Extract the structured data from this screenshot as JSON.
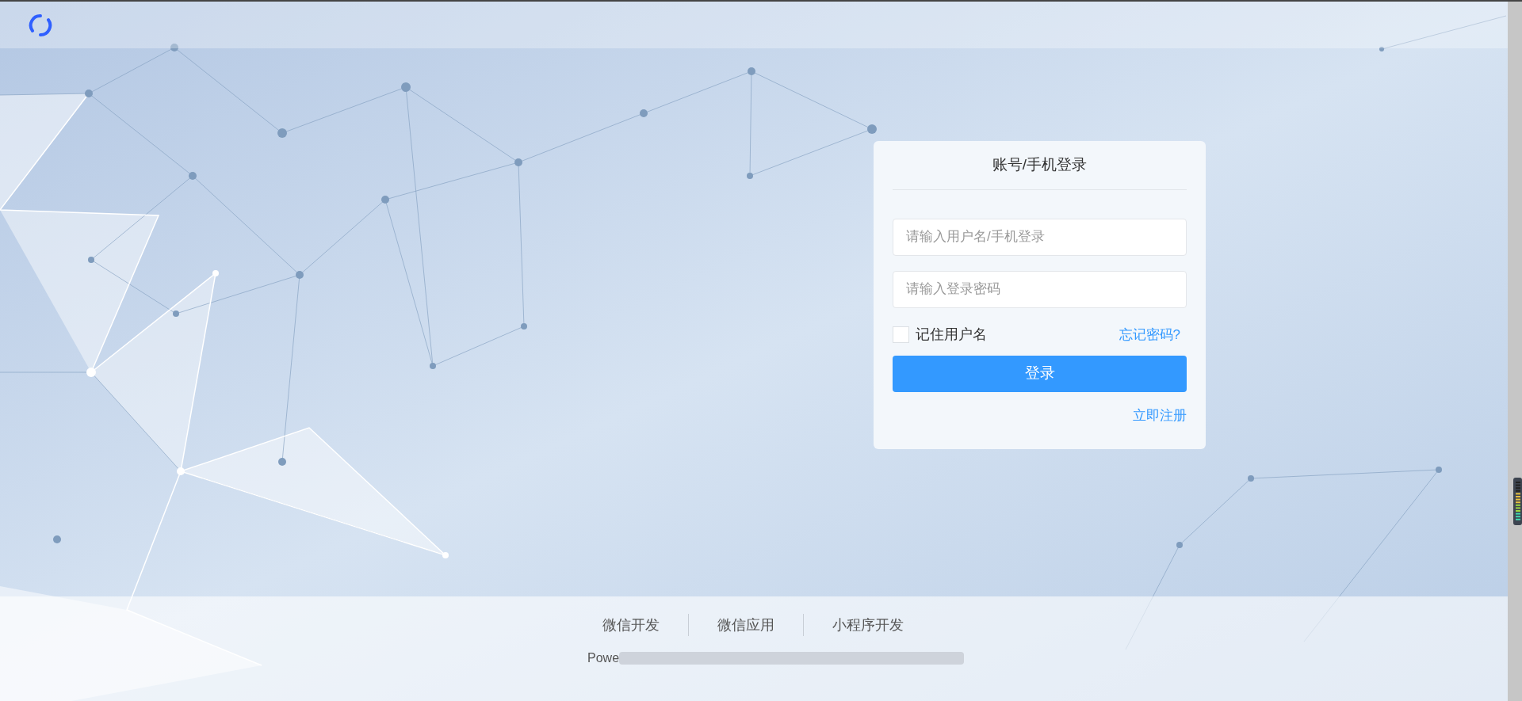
{
  "login_card": {
    "title": "账号/手机登录",
    "username": {
      "placeholder": "请输入用户名/手机登录"
    },
    "password": {
      "placeholder": "请输入登录密码"
    },
    "remember": {
      "label": "记住用户名",
      "checked": false
    },
    "forgot_link": "忘记密码?",
    "submit_button": "登录",
    "register_link": "立即注册"
  },
  "footer": {
    "links": [
      "微信开发",
      "微信应用",
      "小程序开发"
    ],
    "powered_by": "Powe"
  }
}
